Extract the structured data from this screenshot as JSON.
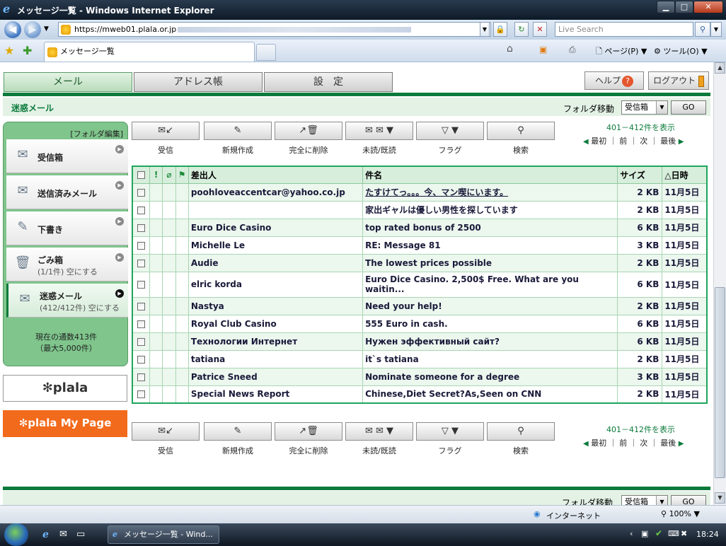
{
  "browser": {
    "window_title": "メッセージ一覧 - Windows Internet Explorer",
    "address": "https://mweb01.plala.or.jp",
    "search_placeholder": "Live Search",
    "tab_title": "メッセージ一覧",
    "cmd_page": "ページ(P)",
    "cmd_tools": "ツール(O)",
    "status_zone": "インターネット",
    "zoom": "100%"
  },
  "taskbar": {
    "window_item": "メッセージ一覧 - Wind...",
    "clock": "18:24"
  },
  "tabs": {
    "mail": "メール",
    "address_book": "アドレス帳",
    "settings": "設　定"
  },
  "top_buttons": {
    "help": "ヘルプ",
    "help_icon_glyph": "?",
    "logout": "ログアウト"
  },
  "subbar": {
    "current_folder": "迷惑メール",
    "folder_move_label": "フォルダ移動",
    "folder_move_value": "受信箱",
    "go": "GO"
  },
  "sidebar": {
    "edit": "[フォルダ編集]",
    "folders": [
      {
        "name": "受信箱",
        "sub": ""
      },
      {
        "name": "送信済みメール",
        "sub": ""
      },
      {
        "name": "下書き",
        "sub": ""
      },
      {
        "name": "ごみ箱",
        "sub": "(1/1件) 空にする"
      },
      {
        "name": "迷惑メール",
        "sub": "(412/412件) 空にする"
      }
    ],
    "count_line1": "現在の通数413件",
    "count_line2": "（最大5,000件）",
    "logo_plala": "plala",
    "logo_mypage": "plala My Page"
  },
  "toolbar": {
    "receive": "受信",
    "compose": "新規作成",
    "delete": "完全に削除",
    "read_unread": "未読/既読",
    "flag": "フラグ",
    "search": "検索"
  },
  "pager": {
    "range": "401－412件を表示",
    "first": "最初",
    "prev": "前",
    "next": "次",
    "last": "最後"
  },
  "table": {
    "headers": {
      "sender": "差出人",
      "subject": "件名",
      "size": "サイズ",
      "date": "△日時"
    },
    "rows": [
      {
        "sender": "poohloveaccentcar@yahoo.co.jp",
        "subject": "たすけてっ。。。今、マン喫にいます。",
        "size": "2 KB",
        "date": "11月5日"
      },
      {
        "sender": "",
        "subject": "家出ギャルは優しい男性を探しています",
        "size": "2 KB",
        "date": "11月5日"
      },
      {
        "sender": "Euro Dice Casino",
        "subject": "top rated bonus of 2500",
        "size": "6 KB",
        "date": "11月5日"
      },
      {
        "sender": "Michelle Le",
        "subject": "RE: Message 81",
        "size": "3 KB",
        "date": "11月5日"
      },
      {
        "sender": "Audie",
        "subject": "The lowest prices possible",
        "size": "2 KB",
        "date": "11月5日"
      },
      {
        "sender": "elric korda",
        "subject": "Euro Dice Casino. 2,500$ Free. What are you waitin...",
        "size": "6 KB",
        "date": "11月5日"
      },
      {
        "sender": "Nastya",
        "subject": "Need your help!",
        "size": "2 KB",
        "date": "11月5日"
      },
      {
        "sender": "Royal Club Casino",
        "subject": "555 Euro in cash.",
        "size": "6 KB",
        "date": "11月5日"
      },
      {
        "sender": "Технологии Интернет",
        "subject": "Нужен эффективный сайт?",
        "size": "6 KB",
        "date": "11月5日"
      },
      {
        "sender": "tatiana",
        "subject": "it`s tatiana",
        "size": "2 KB",
        "date": "11月5日"
      },
      {
        "sender": "Patrice Sneed",
        "subject": "Nominate someone for a degree",
        "size": "3 KB",
        "date": "11月5日"
      },
      {
        "sender": "Special News Report",
        "subject": "Chinese,Diet Secret?As,Seen on CNN",
        "size": "2 KB",
        "date": "11月5日"
      }
    ]
  }
}
